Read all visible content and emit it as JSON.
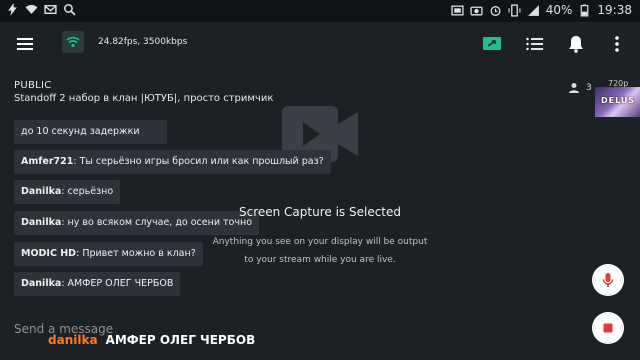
{
  "statusbar": {
    "battery": "40%",
    "time": "19:38",
    "icons": [
      "bolt-icon",
      "wifi-icon",
      "mail-icon",
      "search-icon",
      "cast-icon",
      "camera-icon",
      "alarm-icon",
      "vibrate-icon",
      "cell-signal-icon",
      "battery-icon"
    ]
  },
  "toolbar": {
    "stream_stats": "24.82fps, 3500kbps",
    "icons": [
      "menu-icon",
      "wifi-status-icon",
      "screen-share-icon",
      "list-icon",
      "bell-icon",
      "more-vert-icon"
    ]
  },
  "stream": {
    "visibility": "PUBLIC",
    "title": "Standoff 2 набор в клан |ЮТУБ|, просто стримчик",
    "viewers": "3",
    "resolution": "720p",
    "thumbnail_text": "DELUS"
  },
  "chat": {
    "messages": [
      {
        "author": "",
        "text": "до 10 секунд задержки"
      },
      {
        "author": "Amfer721",
        "text": "Ты серьёзно игры бросил или как прошлый раз?"
      },
      {
        "author": "Danilka",
        "text": "серьёзно"
      },
      {
        "author": "Danilka",
        "text": "ну во всяком случае, до осени точно"
      },
      {
        "author": "MODIC HD",
        "text": "Привет можно в клан?"
      },
      {
        "author": "Danilka",
        "text": "АМФЕР ОЛЕГ ЧЕРБОВ"
      }
    ],
    "input_placeholder": "Send a message"
  },
  "overlay": {
    "title": "Screen Capture is Selected",
    "line1": "Anything you see on your display will be output",
    "line2": "to your stream while you are live."
  },
  "caption": {
    "user": "danilka",
    "text": "АМФЕР ОЛЕГ ЧЕРБОВ"
  },
  "colors": {
    "background": "#1c2126",
    "bubble": "#2d3338",
    "accent_green": "#1fbf8f",
    "record_red": "#e53935",
    "caption_user": "#ff7a1a"
  }
}
